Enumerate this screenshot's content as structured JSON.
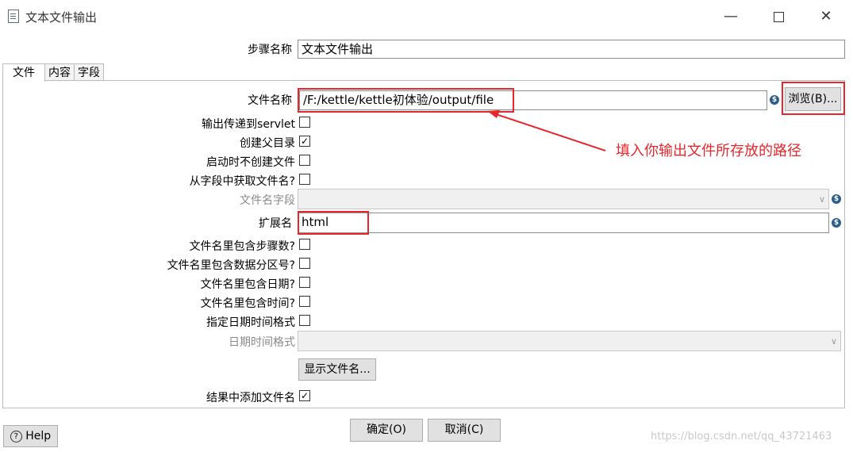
{
  "window": {
    "title": "文本文件输出",
    "minimize": "—",
    "close": "✕"
  },
  "step_name": {
    "label": "步骤名称",
    "value": "文本文件输出"
  },
  "tabs": [
    "文件",
    "内容",
    "字段"
  ],
  "file_tab": {
    "filename_label": "文件名称",
    "filename_value": "/F:/kettle/kettle初体验/output/file",
    "browse_label": "浏览(B)...",
    "pass_to_servlet": {
      "label": "输出传递到servlet",
      "checked": false
    },
    "create_parent": {
      "label": "创建父目录",
      "checked": true
    },
    "no_create_at_start": {
      "label": "启动时不创建文件",
      "checked": false
    },
    "from_field": {
      "label": "从字段中获取文件名?",
      "checked": false
    },
    "filename_field_label": "文件名字段",
    "extension_label": "扩展名",
    "extension_value": "html",
    "include_stepnr": {
      "label": "文件名里包含步骤数?",
      "checked": false
    },
    "include_partnr": {
      "label": "文件名里包含数据分区号?",
      "checked": false
    },
    "include_date": {
      "label": "文件名里包含日期?",
      "checked": false
    },
    "include_time": {
      "label": "文件名里包含时间?",
      "checked": false
    },
    "specify_format": {
      "label": "指定日期时间格式",
      "checked": false
    },
    "datetime_format_label": "日期时间格式",
    "show_filenames_label": "显示文件名...",
    "add_to_result": {
      "label": "结果中添加文件名",
      "checked": true
    }
  },
  "annotation": {
    "text": "填入你输出文件所存放的路径",
    "color": "#e8262c"
  },
  "footer": {
    "help_label": "Help",
    "ok_label": "确定(O)",
    "cancel_label": "取消(C)"
  },
  "watermark": "https://blog.csdn.net/qq_43721463",
  "icons": {
    "checked_glyph": "✓",
    "var_glyph": "$",
    "dropdown_glyph": "∨",
    "help_glyph": "?"
  }
}
